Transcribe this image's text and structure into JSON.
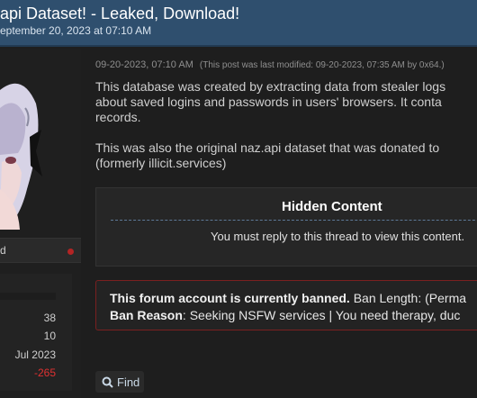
{
  "header": {
    "title": "api Dataset! - Leaked, Download!",
    "date": "eptember 20, 2023 at 07:10 AM"
  },
  "sidebar": {
    "user_status": "d",
    "stats": [
      "38",
      "10",
      "Jul 2023",
      "-265"
    ],
    "status_dot_color": "#b32424"
  },
  "post": {
    "timestamp": "09-20-2023, 07:10 AM",
    "modified": "(This post was last modified: 09-20-2023, 07:35 AM by 0x64.)",
    "body": [
      "This database was created by extracting data from stealer logs",
      "about saved logins and passwords in users' browsers. It conta",
      "records.",
      "",
      "This was also the original naz.api dataset that was donated to",
      "(formerly illicit.services)"
    ],
    "hidden": {
      "title": "Hidden Content",
      "message": "You must reply to this thread to view this content."
    },
    "ban": {
      "line1_bold": "This forum account is currently banned.",
      "line1_rest": " Ban Length: (Perma",
      "line2_bold": "Ban Reason",
      "line2_rest": ": Seeking NSFW services | You need therapy, duc"
    },
    "find_label": "Find"
  },
  "colors": {
    "header_bg": "#2f4f6e",
    "ban_border": "#7a2020",
    "negative": "#e03131"
  }
}
